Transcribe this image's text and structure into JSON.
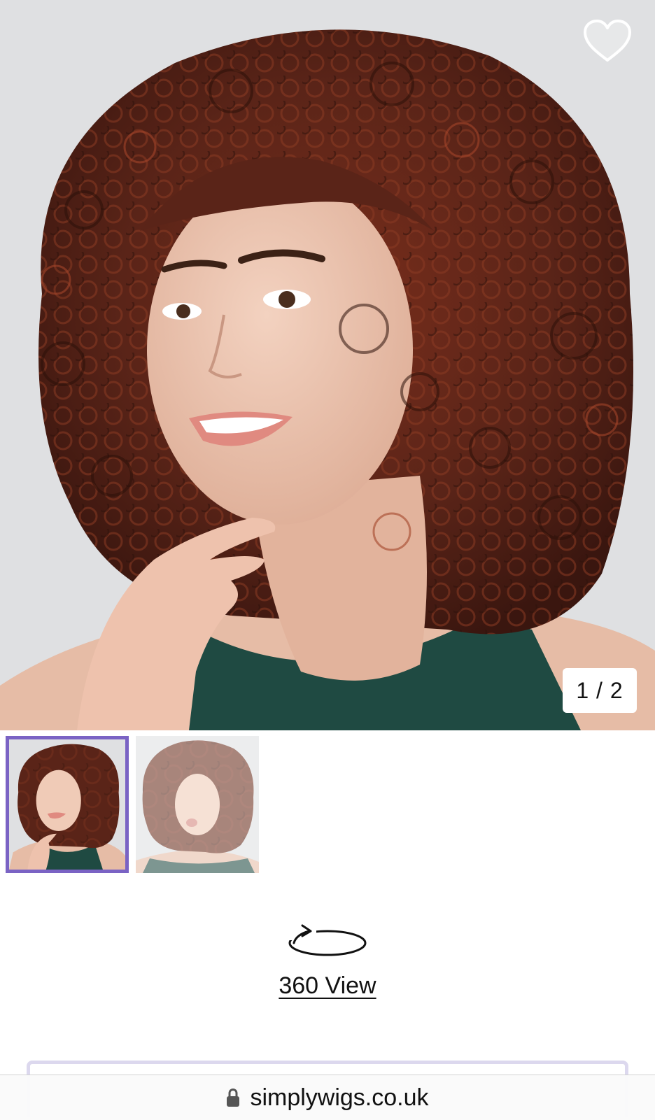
{
  "product_gallery": {
    "main_image_alt": "Model wearing a curly auburn wig",
    "counter": "1 / 2",
    "wishlist_icon": "heart-outline-icon",
    "thumbnails": [
      {
        "alt": "Front view of curly auburn wig",
        "active": true
      },
      {
        "alt": "Side view of curly auburn wig",
        "active": false
      }
    ]
  },
  "view360": {
    "icon": "rotate-360-icon",
    "label": "360 View"
  },
  "browser": {
    "lock_icon": "lock-icon",
    "url": "simplywigs.co.uk"
  },
  "colors": {
    "accent": "#7a63c4",
    "background": "#ffffff",
    "image_backdrop": "#dfe0e2",
    "hair": "#5a2418",
    "top": "#1f4a42"
  }
}
